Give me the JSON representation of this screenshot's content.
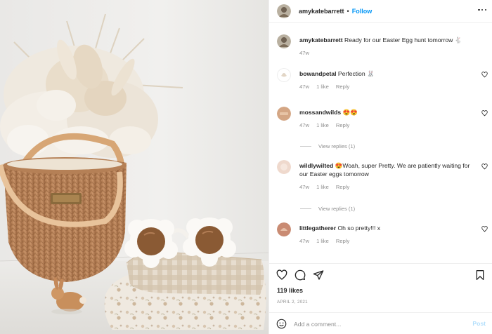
{
  "header": {
    "username": "amykatebarrett",
    "separator": "•",
    "follow_label": "Follow"
  },
  "caption": {
    "username": "amykatebarrett",
    "text": "Ready for our Easter Egg hunt tomorrow 🐇",
    "time": "47w"
  },
  "comments": [
    {
      "username": "bowandpetal",
      "text": "Perfection 🐰",
      "time": "47w",
      "likes": "1 like",
      "reply": "Reply",
      "view_replies": ""
    },
    {
      "username": "mossandwilds",
      "text": "😍😍",
      "time": "47w",
      "likes": "1 like",
      "reply": "Reply",
      "view_replies": "View replies (1)"
    },
    {
      "username": "wildlywilted",
      "text": "😍Woah, super Pretty. We are patiently waiting for our Easter eggs tomorrow",
      "time": "47w",
      "likes": "1 like",
      "reply": "Reply",
      "view_replies": "View replies (1)"
    },
    {
      "username": "littlegatherer",
      "text": "Oh so pretty!!! x",
      "time": "47w",
      "likes": "1 like",
      "reply": "Reply",
      "view_replies": ""
    }
  ],
  "actions": {
    "like_icon": "heart-icon",
    "comment_icon": "speech-bubble-icon",
    "share_icon": "paper-plane-icon",
    "save_icon": "bookmark-icon"
  },
  "likes_text": "119 likes",
  "date_text": "APRIL 2, 2021",
  "composer": {
    "emoji_icon": "smiley-icon",
    "placeholder": "Add a comment...",
    "post_label": "Post"
  },
  "colors": {
    "link_blue": "#0095f6",
    "post_disabled": "#b2dffc",
    "muted_text": "#8e8e8e",
    "divider": "#efefef"
  }
}
